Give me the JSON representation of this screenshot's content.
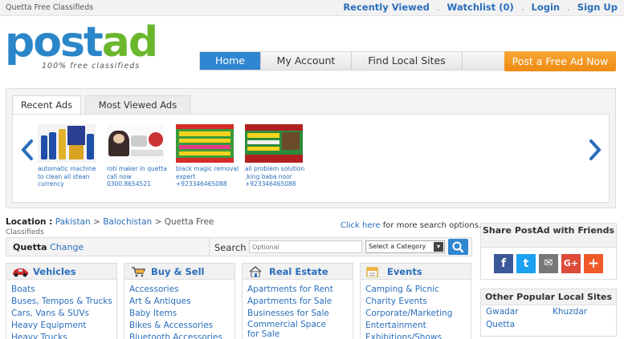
{
  "topbar": {
    "site_name": "Quetta Free Classifieds",
    "recently_viewed": "Recently Viewed",
    "watchlist": "Watchlist",
    "watchlist_count": "(0)",
    "login": "Login",
    "signup": "Sign Up",
    "sep": "."
  },
  "logo": {
    "part1": "post",
    "part2": "ad",
    "tagline": "100% free classifieds"
  },
  "nav": {
    "home": "Home",
    "my_account": "My Account",
    "find_local": "Find Local Sites",
    "post_ad": "Post a Free Ad Now"
  },
  "ads": {
    "tabs": [
      "Recent Ads",
      "Most Viewed Ads"
    ],
    "items": [
      {
        "caption": "automatic machine to clean all stean currency"
      },
      {
        "caption": "roti maker in quetta call now 0300.8654521"
      },
      {
        "caption": "black magic removal expert +923346465088"
      },
      {
        "caption": "all problem solution ,king baba noor +923346465088"
      }
    ]
  },
  "location": {
    "label": "Location :",
    "country": "Pakistan",
    "region": "Balochistan",
    "current": "Quetta Free",
    "current_sub": "Classifieds",
    "arrow": ">",
    "click_here": "Click here",
    "click_rest": "for more search options."
  },
  "search": {
    "city": "Quetta",
    "change": "Change",
    "label": "Search",
    "placeholder": "Optional",
    "category": "Select a Category"
  },
  "categories": [
    {
      "title": "Vehicles",
      "items": [
        "Boats",
        "Buses, Tempos & Trucks",
        "Cars, Vans & SUVs",
        "Heavy Equipment",
        "Heavy Trucks"
      ]
    },
    {
      "title": "Buy & Sell",
      "items": [
        "Accessories",
        "Art & Antiques",
        "Baby Items",
        "Bikes & Accessories",
        "Bluetooth Accessories"
      ]
    },
    {
      "title": "Real Estate",
      "items": [
        "Apartments for Rent",
        "Apartments for Sale",
        "Businesses for Sale",
        "Commercial Space for Sale"
      ]
    },
    {
      "title": "Events",
      "items": [
        "Camping & Picnic",
        "Charity Events",
        "Corporate/Marketing",
        "Entertainment",
        "Exhibitions/Shows"
      ]
    }
  ],
  "share": {
    "title": "Share PostAd with Friends",
    "icons": [
      "f",
      "t",
      "✉",
      "G+",
      "+"
    ],
    "colors": {
      "facebook": "#3b5998",
      "twitter": "#1da1f2",
      "email": "#777777",
      "gplus": "#dd4b39",
      "plus": "#f05a28"
    }
  },
  "popular": {
    "title": "Other Popular Local Sites",
    "sites": [
      "Gwadar",
      "Khuzdar",
      "Quetta"
    ]
  },
  "colors": {
    "accent": "#2f86d1",
    "link": "#2a6ebb",
    "post_btn": "#f39a1e",
    "logo_blue": "#2a86c9",
    "logo_green": "#6ab72d"
  }
}
